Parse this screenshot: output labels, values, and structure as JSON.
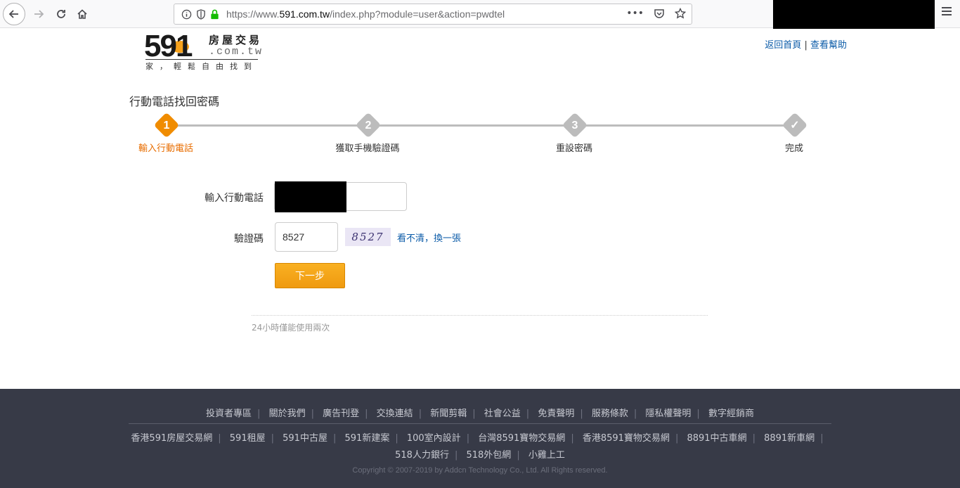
{
  "browser": {
    "url_prefix": "https://www.",
    "url_host": "591.com.tw",
    "url_path": "/index.php?module=user&action=pwdtel",
    "more_icon": "•••"
  },
  "header": {
    "logo_number": "591",
    "logo_cn": "房屋交易",
    "logo_domain": ".com.tw",
    "logo_slogan": "家，輕鬆自由找到",
    "link_home": "返回首頁",
    "link_sep": "|",
    "link_help": "查看幫助"
  },
  "page": {
    "title": "行動電話找回密碼"
  },
  "steps": [
    {
      "num": "1",
      "label": "輸入行動電話",
      "active": true
    },
    {
      "num": "2",
      "label": "獲取手機驗證碼",
      "active": false
    },
    {
      "num": "3",
      "label": "重設密碼",
      "active": false
    },
    {
      "num": "✓",
      "label": "完成",
      "active": false
    }
  ],
  "form": {
    "phone_label": "輸入行動電話",
    "captcha_label": "驗證碼",
    "captcha_value": "8527",
    "captcha_image_text": "8527",
    "refresh_link": "看不清，換一張",
    "next_button": "下一步",
    "note": "24小時僅能使用兩次"
  },
  "footer": {
    "row1": [
      "投資者專區",
      "關於我們",
      "廣告刊登",
      "交換連結",
      "新聞剪輯",
      "社會公益",
      "免責聲明",
      "服務條款",
      "隱私權聲明",
      "數字經銷商"
    ],
    "row2": [
      "香港591房屋交易網",
      "591租屋",
      "591中古屋",
      "591新建案",
      "100室內設計",
      "台灣8591寶物交易網",
      "香港8591寶物交易網",
      "8891中古車網",
      "8891新車網"
    ],
    "row3": [
      "518人力銀行",
      "518外包網",
      "小雞上工"
    ],
    "copyright": "Copyright © 2007-2019 by Addcn Technology Co., Ltd. All Rights reserved."
  },
  "colors": {
    "accent_orange": "#f08c00",
    "link_blue": "#0b5ba8",
    "footer_bg": "#373a47"
  }
}
